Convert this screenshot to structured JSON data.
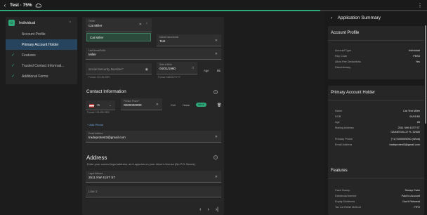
{
  "topbar": {
    "title": "Test · 75%",
    "progress_fraction": 0.75
  },
  "nav": {
    "header": "Individual",
    "items": [
      {
        "label": "Account Profile",
        "active": false,
        "done": false
      },
      {
        "label": "Primary Account Holder",
        "active": true,
        "done": false
      },
      {
        "label": "Features",
        "active": false,
        "done": true
      },
      {
        "label": "Trusted Contact Informati...",
        "active": false,
        "done": true
      },
      {
        "label": "Additional Forms",
        "active": false,
        "done": true
      }
    ]
  },
  "form": {
    "owner_label": "Owner",
    "owner_value": "Cat Miller",
    "dropdown_option": "Cat Miller",
    "first_name_label": "Middle Name/Initial",
    "first_name_value": "Test",
    "last_name_label": "Last Name/Suffix",
    "last_name_value": "Miller",
    "ssn_placeholder": "Social Security Number*",
    "ssn_helper": "Format: 123-45-6789",
    "dob_label": "Date of Birth",
    "dob_value": "04/01/1960",
    "dob_helper": "Format: MM/DD/YYYY",
    "age_label": "Age",
    "age_value": "65",
    "contact_title": "Contact Information",
    "phone_code": "+1",
    "phone_label": "Primary Phone*",
    "phone_value": "0000000000",
    "phone_helper": "Format: 123-456-7890",
    "phone_types": [
      "Cell",
      "Home",
      "Work"
    ],
    "add_phone": "+ Add Phone",
    "email_label": "Email Address",
    "email_value": "tradeprotest3@gmail.com",
    "address_title": "Address",
    "address_desc": "Enter your current legal address, as it appears on your driver's license (No P.O. Boxes).",
    "address_label": "Legal Address",
    "address_value": "2511 NW 41ST ST",
    "line2_placeholder": "Line 2"
  },
  "summary": {
    "title": "Application Summary",
    "account_profile": {
      "title": "Account Profile",
      "rows": [
        {
          "k": "Account Type",
          "v": "Individual"
        },
        {
          "k": "Rep Code",
          "v": "PBS3"
        },
        {
          "k": "Allow Fee Deductions",
          "v": "Yes"
        },
        {
          "k": "Discretionary",
          "v": ""
        }
      ]
    },
    "primary_holder": {
      "title": "Primary Account Holder",
      "rows": [
        {
          "k": "Name",
          "v": "Cat Test Miller"
        },
        {
          "k": "DOB",
          "v": "04/01/60"
        },
        {
          "k": "Age",
          "v": "65"
        },
        {
          "k": "Mailing Address",
          "v": "2511 NW 41ST ST"
        },
        {
          "k": "",
          "v": "GAINESVILLE FL 32606"
        },
        {
          "k": "Primary Phone",
          "v": "(+1) 0000000000 (Work)"
        },
        {
          "k": "Email Address",
          "v": "tradeprotest3@gmail.com"
        }
      ]
    },
    "features": {
      "title": "Features",
      "rows": [
        {
          "k": "Cash Sweep",
          "v": "Sweep Cash"
        },
        {
          "k": "Dividends/Interest",
          "v": "Paid to Account"
        },
        {
          "k": "Equity Dividends",
          "v": "Don't Reinvest"
        },
        {
          "k": "Tax Lot Relief Method",
          "v": "FIFO"
        }
      ]
    }
  }
}
